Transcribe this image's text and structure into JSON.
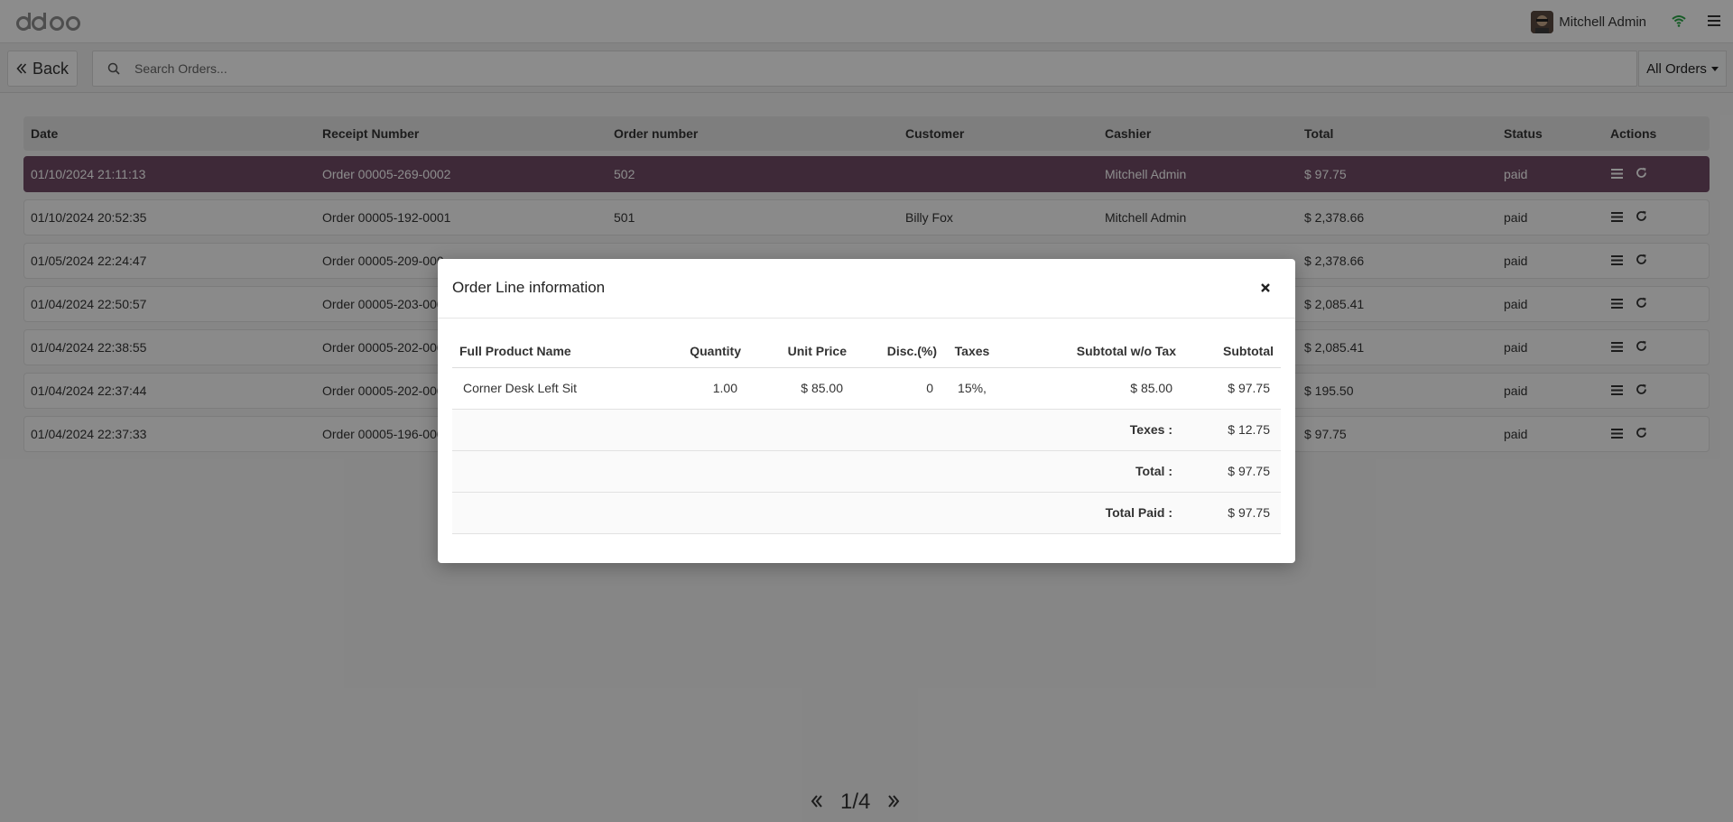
{
  "navbar": {
    "user_name": "Mitchell Admin",
    "icons": [
      "odoo-logo",
      "user-avatar",
      "wifi-icon",
      "hamburger-menu-icon"
    ],
    "accent_wifi": "#28a745"
  },
  "controls": {
    "back_label": "Back",
    "search_placeholder": "Search Orders...",
    "filter_label": "All Orders"
  },
  "orders": {
    "headers": {
      "date": "Date",
      "receipt": "Receipt Number",
      "order_number": "Order number",
      "customer": "Customer",
      "cashier": "Cashier",
      "total": "Total",
      "status": "Status",
      "actions": "Actions"
    },
    "rows": [
      {
        "date": "01/10/2024 21:11:13",
        "receipt": "Order 00005-269-0002",
        "order_number": "502",
        "customer": "",
        "cashier": "Mitchell Admin",
        "total": "$ 97.75",
        "status": "paid"
      },
      {
        "date": "01/10/2024 20:52:35",
        "receipt": "Order 00005-192-0001",
        "order_number": "501",
        "customer": "Billy Fox",
        "cashier": "Mitchell Admin",
        "total": "$ 2,378.66",
        "status": "paid"
      },
      {
        "date": "01/05/2024 22:24:47",
        "receipt": "Order 00005-209-000",
        "order_number": "",
        "customer": "",
        "cashier": "",
        "total": "$ 2,378.66",
        "status": "paid"
      },
      {
        "date": "01/04/2024 22:50:57",
        "receipt": "Order 00005-203-000",
        "order_number": "",
        "customer": "",
        "cashier": "",
        "total": "$ 2,085.41",
        "status": "paid"
      },
      {
        "date": "01/04/2024 22:38:55",
        "receipt": "Order 00005-202-000",
        "order_number": "",
        "customer": "",
        "cashier": "",
        "total": "$ 2,085.41",
        "status": "paid"
      },
      {
        "date": "01/04/2024 22:37:44",
        "receipt": "Order 00005-202-000",
        "order_number": "",
        "customer": "",
        "cashier": "",
        "total": "$ 195.50",
        "status": "paid"
      },
      {
        "date": "01/04/2024 22:37:33",
        "receipt": "Order 00005-196-000",
        "order_number": "",
        "customer": "",
        "cashier": "",
        "total": "$ 97.75",
        "status": "paid"
      }
    ],
    "selected_color": "#714b67"
  },
  "pager": {
    "value": "1/4"
  },
  "modal": {
    "title": "Order Line information",
    "headers": {
      "product": "Full Product Name",
      "quantity": "Quantity",
      "unit_price": "Unit Price",
      "discount": "Disc.(%)",
      "taxes": "Taxes",
      "subtotal_wo_tax": "Subtotal w/o Tax",
      "subtotal": "Subtotal"
    },
    "line": {
      "product": "Corner Desk Left Sit",
      "quantity": "1.00",
      "unit_price": "$ 85.00",
      "discount": "0",
      "taxes": "15%,",
      "subtotal_wo_tax": "$ 85.00",
      "subtotal": "$ 97.75"
    },
    "summary": [
      {
        "label": "Texes :",
        "value": "$ 12.75"
      },
      {
        "label": "Total :",
        "value": "$ 97.75"
      },
      {
        "label": "Total Paid :",
        "value": "$ 97.75"
      }
    ]
  }
}
